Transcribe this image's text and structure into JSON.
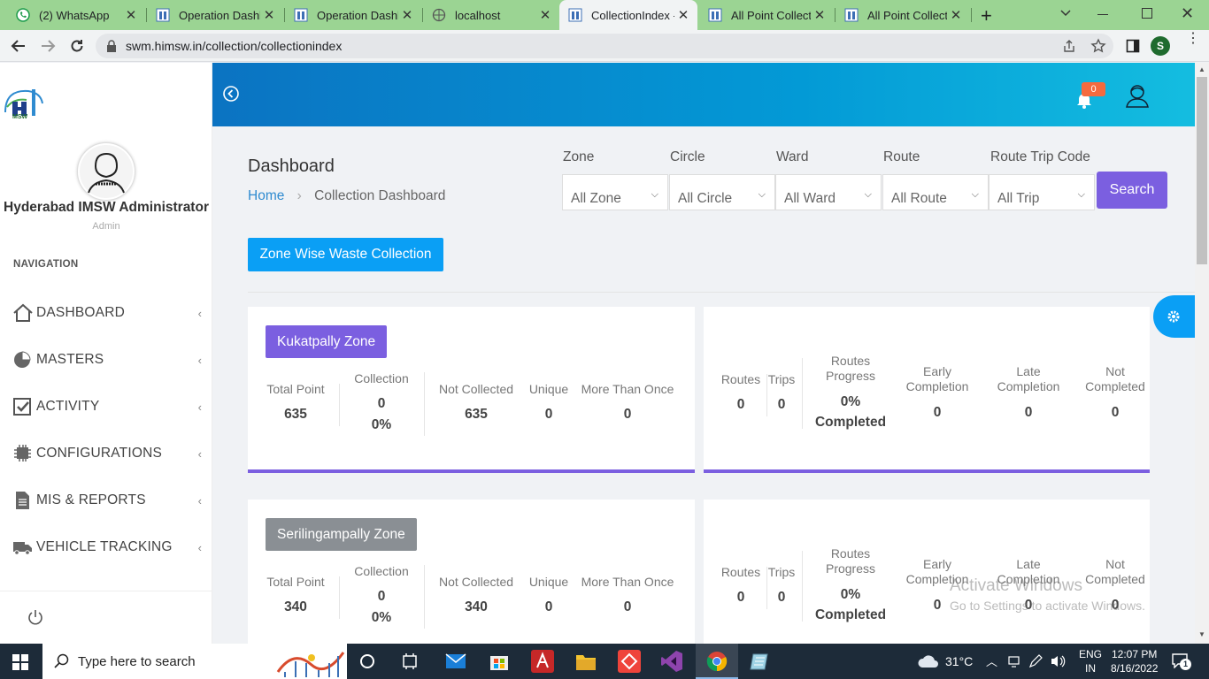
{
  "browser": {
    "tabs": [
      {
        "label": "(2) WhatsApp",
        "active": false
      },
      {
        "label": "Operation Dashb",
        "active": false
      },
      {
        "label": "Operation Dashb",
        "active": false
      },
      {
        "label": "localhost",
        "active": false
      },
      {
        "label": "CollectionIndex -",
        "active": true
      },
      {
        "label": "All Point Collecti",
        "active": false
      },
      {
        "label": "All Point Collecti",
        "active": false
      }
    ],
    "url": "swm.himsw.in/collection/collectionindex",
    "profile_initial": "S"
  },
  "sidebar": {
    "logo_text": "MSW",
    "user_name": "Hyderabad IMSW Administrator",
    "user_role": "Admin",
    "nav_heading": "NAVIGATION",
    "items": [
      {
        "label": "DASHBOARD",
        "icon": "home-icon"
      },
      {
        "label": "MASTERS",
        "icon": "pie-chart-icon"
      },
      {
        "label": "ACTIVITY",
        "icon": "checkbox-icon"
      },
      {
        "label": "CONFIGURATIONS",
        "icon": "chip-icon"
      },
      {
        "label": "MIS & REPORTS",
        "icon": "document-icon"
      },
      {
        "label": "VEHICLE TRACKING",
        "icon": "truck-icon"
      }
    ]
  },
  "header": {
    "notification_count": "0"
  },
  "page": {
    "title": "Dashboard",
    "breadcrumb_home": "Home",
    "breadcrumb_current": "Collection Dashboard",
    "section_button": "Zone Wise Waste Collection",
    "search_button": "Search",
    "filters": [
      {
        "label": "Zone",
        "value": "All Zone"
      },
      {
        "label": "Circle",
        "value": "All Circle"
      },
      {
        "label": "Ward",
        "value": "All Ward"
      },
      {
        "label": "Route",
        "value": "All Route"
      },
      {
        "label": "Route Trip Code",
        "value": "All Trip"
      }
    ]
  },
  "labels": {
    "total_point": "Total Point",
    "collection": "Collection",
    "not_collected": "Not Collected",
    "unique": "Unique",
    "more_than_once": "More Than Once",
    "routes": "Routes",
    "trips": "Trips",
    "routes_progress": "Routes Progress",
    "early_completion": "Early Completion",
    "late_completion": "Late Completion",
    "not_completed": "Not Completed"
  },
  "zones": [
    {
      "name": "Kukatpally Zone",
      "badge_color": "#7b5fe0",
      "total_point": "635",
      "collection": "0",
      "collection_pct": "0%",
      "not_collected": "635",
      "unique": "0",
      "more_than_once": "0",
      "routes": "0",
      "trips": "0",
      "routes_progress_pct": "0%",
      "routes_progress_text": "Completed",
      "early_completion": "0",
      "late_completion": "0",
      "not_completed": "0"
    },
    {
      "name": "Serilingampally Zone",
      "badge_color": "#8a8f94",
      "total_point": "340",
      "collection": "0",
      "collection_pct": "0%",
      "not_collected": "340",
      "unique": "0",
      "more_than_once": "0",
      "routes": "0",
      "trips": "0",
      "routes_progress_pct": "0%",
      "routes_progress_text": "Completed",
      "early_completion": "0",
      "late_completion": "0",
      "not_completed": "0"
    }
  ],
  "watermark": {
    "line1": "Activate Windows",
    "line2": "Go to Settings to activate Windows."
  },
  "taskbar": {
    "search_placeholder": "Type here to search",
    "temperature": "31°C",
    "language": "ENG",
    "region": "IN",
    "time": "12:07 PM",
    "date": "8/16/2022",
    "notification_count": "1"
  }
}
